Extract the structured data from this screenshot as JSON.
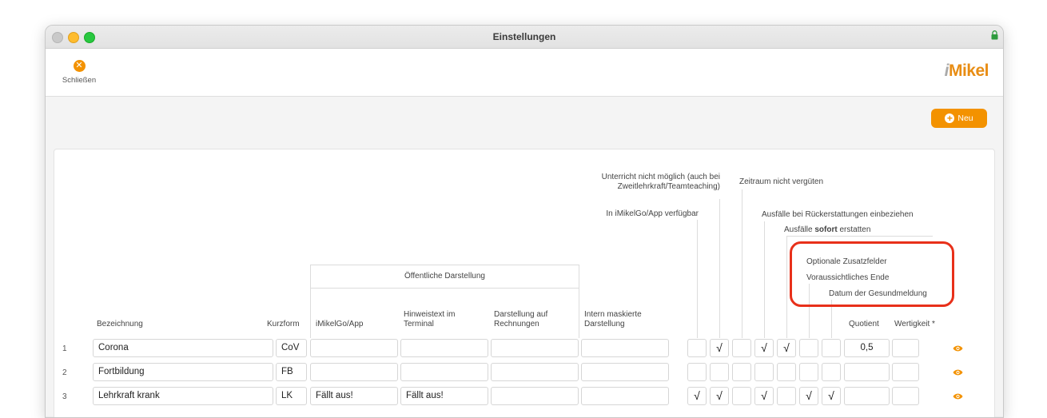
{
  "window": {
    "title": "Einstellungen"
  },
  "toolbar": {
    "close_label": "Schließen",
    "close_glyph": "✕",
    "logo_prefix": "i",
    "logo_text": "Mikel"
  },
  "actions": {
    "new_label": "Neu",
    "new_glyph": "+"
  },
  "headers": {
    "bezeichnung": "Bezeichnung",
    "kurzform": "Kurzform",
    "oeffentlich": "Öffentliche Darstellung",
    "imikelgo": "iMikelGo/App",
    "hinweistext": "Hinweistext im Terminal",
    "rechnungen": "Darstellung auf Rechnungen",
    "intern": "Intern maskierte Darstellung",
    "unterricht": "Unterricht nicht möglich (auch bei Zweitlehrkraft/Teamteaching)",
    "in_app": "In iMikelGo/App verfügbar",
    "zeitraum": "Zeitraum nicht vergüten",
    "ausfaelle_rueck": "Ausfälle bei Rückerstattungen einbeziehen",
    "ausfaelle_sofort_pre": "Ausfälle",
    "ausfaelle_sofort_bold": "sofort",
    "ausfaelle_sofort_post": "erstatten",
    "optionale": "Optionale Zusatzfelder",
    "voraussichtlich": "Voraussichtliches Ende",
    "gesundmeldung": "Datum der Gesundmeldung",
    "quotient": "Quotient",
    "wertigkeit": "Wertigkeit *"
  },
  "check_glyph": "√",
  "rows": [
    {
      "num": "1",
      "bezeichnung": "Corona",
      "kurzform": "CoV",
      "imikelgo": "",
      "hinweis": "",
      "rechnung": "",
      "intern": "",
      "quotient": "0,5",
      "wertigkeit": ""
    },
    {
      "num": "2",
      "bezeichnung": "Fortbildung",
      "kurzform": "FB",
      "imikelgo": "",
      "hinweis": "",
      "rechnung": "",
      "intern": "",
      "quotient": "",
      "wertigkeit": ""
    },
    {
      "num": "3",
      "bezeichnung": "Lehrkraft krank",
      "kurzform": "LK",
      "imikelgo": "Fällt aus!",
      "hinweis": "Fällt aus!",
      "rechnung": "",
      "intern": "",
      "quotient": "",
      "wertigkeit": ""
    }
  ],
  "checks": [
    [
      false,
      true,
      false,
      true,
      true,
      false,
      false
    ],
    [
      false,
      false,
      false,
      false,
      false,
      false,
      false
    ],
    [
      true,
      true,
      false,
      true,
      false,
      true,
      true
    ]
  ],
  "colors": {
    "accent": "#f39200",
    "highlight": "#e8301a"
  }
}
